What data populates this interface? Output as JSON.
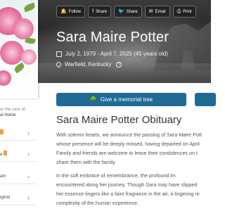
{
  "share_bar": {
    "follow": "Follow",
    "share_facebook": "Share",
    "share_twitter": "Share",
    "email": "Email",
    "print": "Print"
  },
  "deceased": {
    "name": "Sara Maire Potter",
    "dates": "July 2, 1979 - April 7, 2025 (45 years old)",
    "location": "Warfield, Kentucky"
  },
  "sidebar": {
    "care_line1": "er the care of",
    "care_line2": "al Home",
    "items": [
      {
        "label": ""
      },
      {
        "label": "e"
      },
      {
        "label": "am"
      },
      {
        "label": "iginal"
      }
    ]
  },
  "actions": {
    "memorial_tree": "Give a memorial tree"
  },
  "obituary": {
    "title": "Sara Maire Potter Obituary",
    "p1": [
      "With solemn hearts, we announce the passing of Sara Maire Pott",
      "whose presence will be deeply missed, having departed on April",
      "Family and friends are welcome to leave their condolences on t",
      "share them with the family."
    ],
    "p2": [
      "In the soft embrace of remembrance, the profound im",
      "encountered along her journey. Though Sara may have slipped",
      "her essence lingers like a faint fragrance in the air, a lingering re",
      "complexity of the human experience."
    ]
  },
  "colors": {
    "accent": "#1f6b96",
    "badge": "#f0a030"
  },
  "icons": [
    "follow-bell-icon",
    "facebook-icon",
    "twitter-icon",
    "email-icon",
    "print-icon",
    "calendar-icon",
    "location-pin-icon",
    "info-icon",
    "tree-icon",
    "chevron-right-icon"
  ]
}
